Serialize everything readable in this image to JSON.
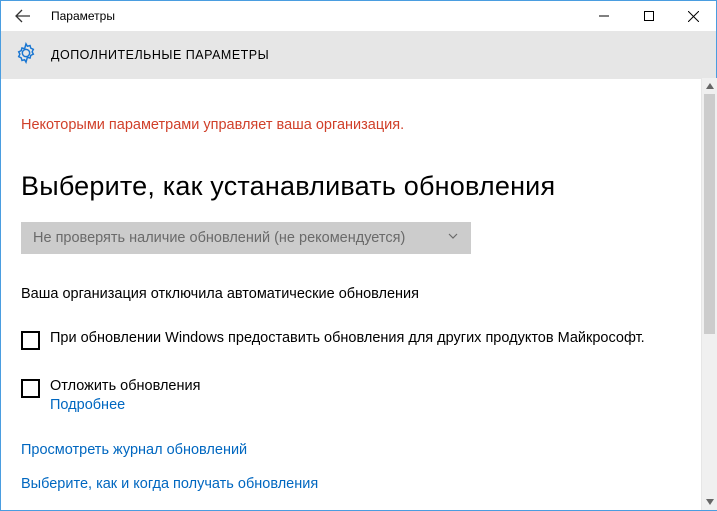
{
  "titlebar": {
    "title": "Параметры"
  },
  "header": {
    "heading": "ДОПОЛНИТЕЛЬНЫЕ ПАРАМЕТРЫ"
  },
  "content": {
    "org_warning": "Некоторыми параметрами управляет ваша организация.",
    "section_title": "Выберите, как устанавливать обновления",
    "dropdown_value": "Не проверять наличие обновлений (не рекомендуется)",
    "disabled_note": "Ваша организация отключила автоматические обновления",
    "checkbox1_label": "При обновлении Windows предоставить обновления для других продуктов Майкрософт.",
    "checkbox2_label": "Отложить обновления",
    "checkbox2_sublink": "Подробнее",
    "link_history": "Просмотреть журнал обновлений",
    "link_choose": "Выберите, как и когда получать обновления"
  }
}
